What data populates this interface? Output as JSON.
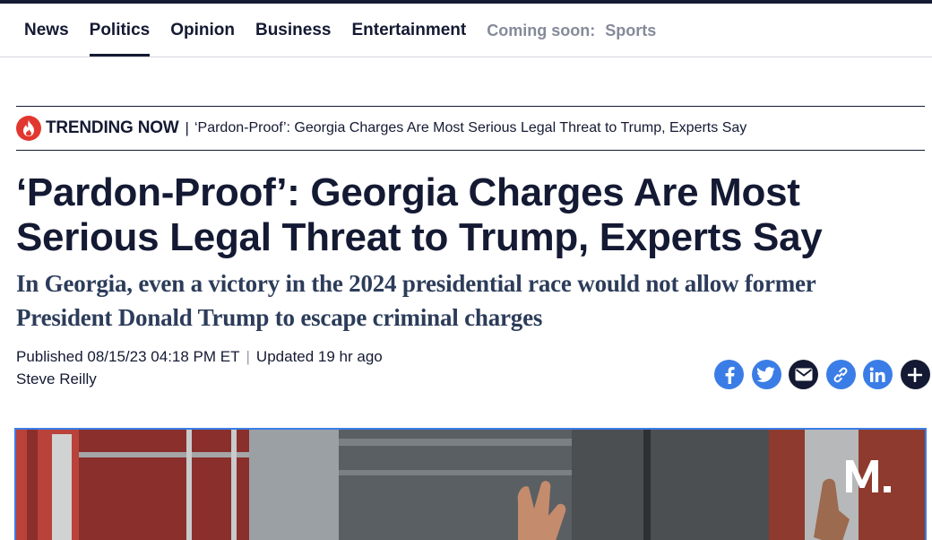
{
  "nav": {
    "items": [
      {
        "label": "News",
        "active": false
      },
      {
        "label": "Politics",
        "active": true
      },
      {
        "label": "Opinion",
        "active": false
      },
      {
        "label": "Business",
        "active": false
      },
      {
        "label": "Entertainment",
        "active": false
      }
    ],
    "coming_soon_label": "Coming soon:",
    "coming_soon_item": "Sports"
  },
  "trending": {
    "icon": "flame-icon",
    "label": "TRENDING NOW",
    "separator": "|",
    "link": "‘Pardon-Proof’: Georgia Charges Are Most Serious Legal Threat to Trump, Experts Say"
  },
  "article": {
    "headline": "‘Pardon-Proof’: Georgia Charges Are Most Serious Legal Threat to Trump, Experts Say",
    "dek": "In Georgia, even a victory in the 2024 presidential race would not allow former President Donald Trump to escape criminal charges",
    "published": "Published 08/15/23 04:18 PM ET",
    "divider": "|",
    "updated": "Updated 19 hr ago",
    "author": "Steve Reilly"
  },
  "share": {
    "buttons": [
      "facebook-icon",
      "twitter-icon",
      "email-icon",
      "link-icon",
      "linkedin-icon",
      "plus-icon"
    ]
  },
  "media": {
    "watermark": "M."
  },
  "colors": {
    "navy": "#141a33",
    "share_blue": "#3b7de6",
    "trending_red": "#e2372f",
    "muted": "#858a99"
  }
}
